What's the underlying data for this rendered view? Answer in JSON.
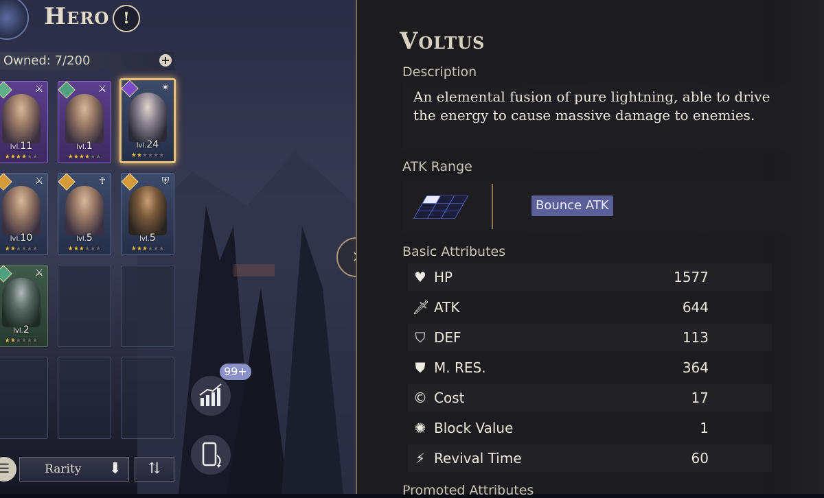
{
  "header": {
    "title": "Hero",
    "help_glyph": "!"
  },
  "roster": {
    "owned_label": "Owned: 7/200",
    "add_glyph": "+",
    "cards": [
      {
        "level": "11",
        "lvl_prefix": "lvl.",
        "stars": 4,
        "max_stars": 6,
        "rarity": "purple",
        "class_icon": "crossed-swords-icon",
        "element_icon": "diamond-icon"
      },
      {
        "level": "1",
        "lvl_prefix": "lvl.",
        "stars": 4,
        "max_stars": 6,
        "rarity": "purple",
        "class_icon": "crossed-swords-icon",
        "element_icon": "diamond-icon"
      },
      {
        "level": "24",
        "lvl_prefix": "lvl.",
        "stars": 2,
        "max_stars": 6,
        "rarity": "blue",
        "class_icon": "spark-icon",
        "element_icon": "lightning-icon",
        "selected": true
      },
      {
        "level": "10",
        "lvl_prefix": "lvl.",
        "stars": 2,
        "max_stars": 6,
        "rarity": "blue",
        "class_icon": "crossed-swords-icon",
        "element_icon": "diamond-icon"
      },
      {
        "level": "5",
        "lvl_prefix": "lvl.",
        "stars": 3,
        "max_stars": 6,
        "rarity": "blue",
        "class_icon": "praying-hands-icon",
        "element_icon": "diamond-icon"
      },
      {
        "level": "5",
        "lvl_prefix": "lvl.",
        "stars": 3,
        "max_stars": 6,
        "rarity": "blue",
        "class_icon": "shield-icon",
        "element_icon": "diamond-icon"
      },
      {
        "level": "2",
        "lvl_prefix": "lvl.",
        "stars": 2,
        "max_stars": 6,
        "rarity": "green",
        "class_icon": "crossed-swords-icon",
        "element_icon": "diamond-icon"
      }
    ]
  },
  "sort": {
    "label": "Rarity"
  },
  "notifications": {
    "badge": "99+"
  },
  "detail": {
    "name": "Voltus",
    "description_label": "Description",
    "description": "An elemental fusion of pure lightning, able to drive the energy to cause massive damage to enemies.",
    "atk_range_label": "ATK Range",
    "range_tag": "Bounce ATK",
    "basic_attributes_label": "Basic Attributes",
    "attributes": [
      {
        "name": "HP",
        "value": "1577",
        "icon": "heart-icon"
      },
      {
        "name": "ATK",
        "value": "644",
        "icon": "sword-icon"
      },
      {
        "name": "DEF",
        "value": "113",
        "icon": "shield-icon"
      },
      {
        "name": "M. RES.",
        "value": "364",
        "icon": "magic-shield-icon"
      },
      {
        "name": "Cost",
        "value": "17",
        "icon": "cost-icon"
      },
      {
        "name": "Block Value",
        "value": "1",
        "icon": "block-icon"
      },
      {
        "name": "Revival Time",
        "value": "60",
        "icon": "revival-icon"
      }
    ],
    "next_section_label": "Promoted Attributes"
  }
}
